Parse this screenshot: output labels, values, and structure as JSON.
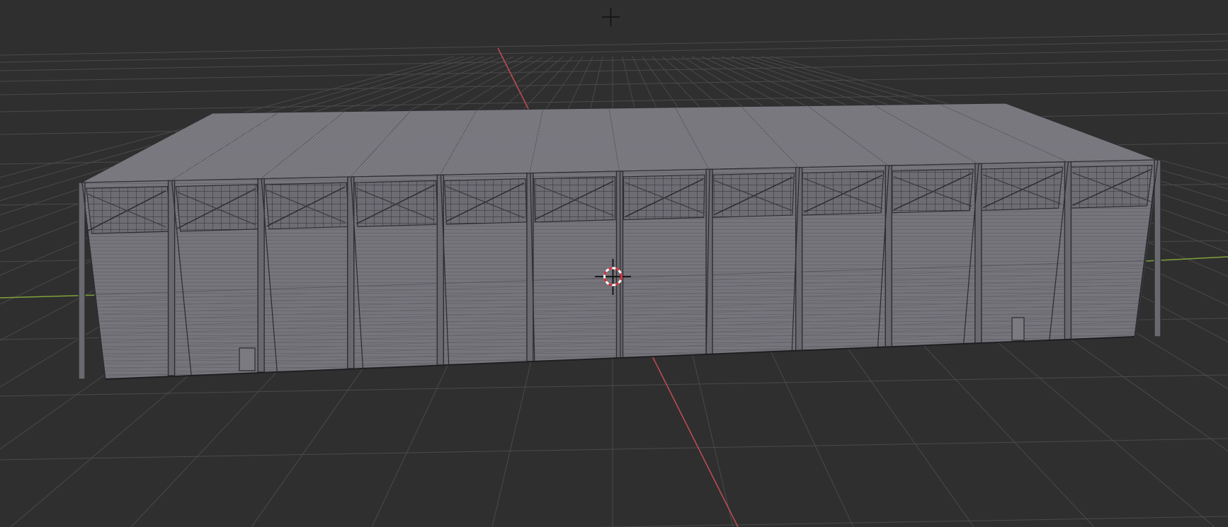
{
  "viewport": {
    "name": "3D Viewport",
    "shading": "solid",
    "background_color": "#2f2f2f",
    "grid_color": "#4a4a4a",
    "x_axis_color": "#c24d55",
    "y_axis_color": "#7fa33a"
  },
  "scene": {
    "object": "hangar-building",
    "bay_count": 12,
    "wall_color": "#77767d",
    "roof_color": "#7d7c83",
    "wire_color": "#2e2e33",
    "door_count": 2
  },
  "overlays": {
    "cursor_icon": "crosshair-cursor-icon",
    "origin_icon": "3d-cursor-icon",
    "cursor_ring_colors": [
      "#ffffff",
      "#d0303a"
    ]
  }
}
